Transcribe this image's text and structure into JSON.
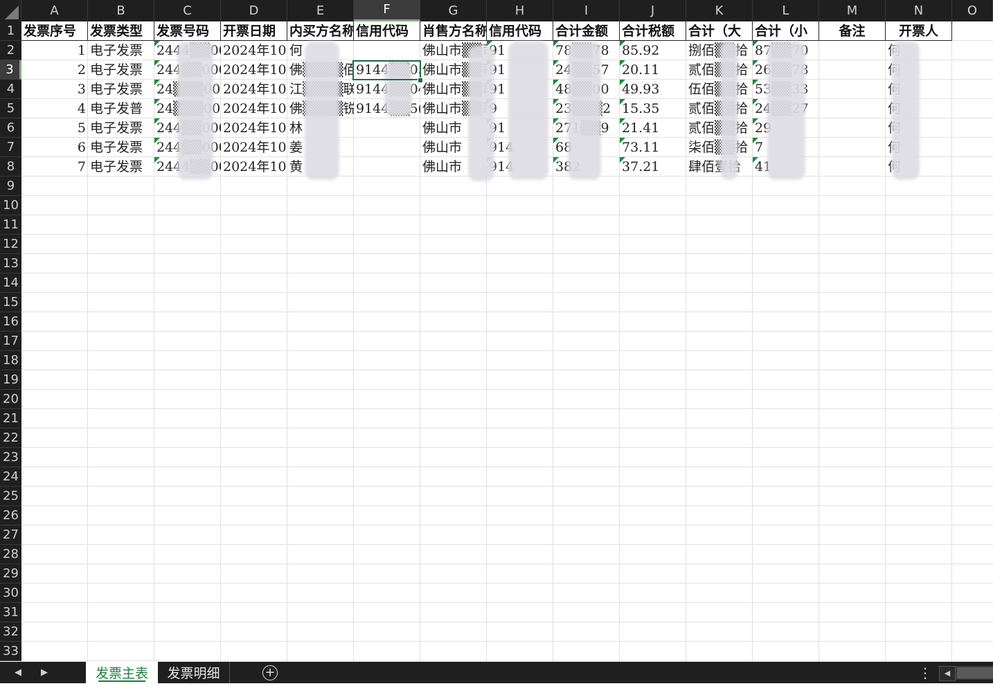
{
  "columns": [
    "A",
    "B",
    "C",
    "D",
    "E",
    "F",
    "G",
    "H",
    "I",
    "J",
    "K",
    "L",
    "M",
    "N",
    "O"
  ],
  "selected_column": "F",
  "selected_row": "3",
  "rows": [
    "1",
    "2",
    "3",
    "4",
    "5",
    "6",
    "7",
    "8",
    "9",
    "10",
    "11",
    "12",
    "13",
    "14",
    "15",
    "16",
    "17",
    "18",
    "19",
    "20",
    "21",
    "22",
    "23",
    "24",
    "25",
    "26",
    "27",
    "28",
    "29",
    "30",
    "31",
    "32",
    "33"
  ],
  "header_row": [
    "发票序号",
    "发票类型",
    "发票号码",
    "开票日期",
    "购买方名称",
    "信用代码",
    "销售方名称",
    "信用代码",
    "合计金额",
    "合计税额",
    "合计（大",
    "合计（小",
    "备注",
    "开票人"
  ],
  "header_display": [
    "发票序号",
    "发票类型",
    "发票号码",
    "开票日期",
    "内买方名称",
    "信用代码",
    "肖售方名称",
    "信用代码",
    "合计金额",
    "合计税额",
    "合计（大",
    "合计（小",
    "备注",
    "开票人"
  ],
  "data_rows": [
    [
      "1",
      "电子发票",
      "2444",
      "2024年10",
      "何",
      "",
      "佛山市",
      "91",
      "78",
      "85.92",
      "捌佰",
      "87",
      "",
      "何"
    ],
    [
      "2",
      "电子发票",
      "244",
      "2024年10",
      "佛",
      "9144",
      "佛山市",
      "91",
      "24",
      "20.11",
      "贰佰",
      "26",
      "",
      "何"
    ],
    [
      "3",
      "电子发票",
      "24",
      "2024年10",
      "江",
      "9144",
      "佛山市",
      "91",
      "48",
      "49.93",
      "伍佰",
      "53",
      "",
      "何"
    ],
    [
      "4",
      "电子发普",
      "24",
      "2024年10",
      "佛",
      "9144",
      "佛山市",
      "9",
      "23",
      "15.35",
      "贰佰",
      "24",
      "",
      "何"
    ],
    [
      "5",
      "电子发票",
      "244",
      "2024年10",
      "林",
      "",
      "佛山市",
      "91",
      "271",
      "21.41",
      "贰佰",
      "29",
      "",
      "何"
    ],
    [
      "6",
      "电子发票",
      "244",
      "2024年10",
      "姜",
      "",
      "佛山市",
      "914",
      "68",
      "73.11",
      "柒佰",
      "7",
      "",
      "何"
    ],
    [
      "7",
      "电子发票",
      "2444",
      "2024年10",
      "黄",
      "",
      "佛山市",
      "914",
      "382",
      "37.21",
      "肆佰壹拾",
      "41",
      "",
      "何"
    ]
  ],
  "data_display": [
    [
      "1",
      "电子发票",
      "2444▒▒000(",
      "2024年10",
      "何",
      "",
      "佛山市▒▒司",
      "91",
      "78▒▒78",
      "85.92",
      "捌佰▒▒拾",
      "87▒▒70",
      "",
      "何"
    ],
    [
      "2",
      "电子发票",
      "244▒▒000(",
      "2024年10",
      "佛▒▒▒▒佰",
      "9144▒▒05",
      "佛山市▒▒司",
      "91",
      "24▒▒57",
      "20.11",
      "贰佰▒▒拾",
      "26▒▒78",
      "",
      "何"
    ],
    [
      "3",
      "电子发票",
      "24▒▒▒000(",
      "2024年10",
      "江▒▒▒▒联",
      "9144▒▒04",
      "佛山市▒▒司",
      "91",
      "48▒▒00",
      "49.93",
      "伍佰▒▒拾",
      "53▒▒33",
      "",
      "何"
    ],
    [
      "4",
      "电子发普",
      "24▒▒▒000(",
      "2024年10",
      "佛▒▒▒▒锐",
      "9144▒▒5(",
      "佛山市▒▒司",
      "9",
      "23▒▒▒2",
      "15.35",
      "贰佰▒▒拾",
      "24▒▒27",
      "",
      "何"
    ],
    [
      "5",
      "电子发票",
      "244▒▒000(",
      "2024年10",
      "林",
      "",
      "佛山市",
      "91",
      "271▒▒9",
      "21.41",
      "贰佰▒▒拾",
      "29",
      "",
      "何"
    ],
    [
      "6",
      "电子发票",
      "244▒▒000(",
      "2024年10",
      "姜",
      "",
      "佛山市",
      "914",
      "68",
      "73.11",
      "柒佰▒▒拾",
      "7",
      "",
      "何"
    ],
    [
      "7",
      "电子发票",
      "2444▒▒00(",
      "2024年10",
      "黄",
      "",
      "佛山市",
      "914",
      "382",
      "37.21",
      "肆佰壹拾",
      "41",
      "",
      "何"
    ]
  ],
  "sheet_tabs": [
    {
      "label": "发票主表",
      "active": true
    },
    {
      "label": "发票明细",
      "active": false
    }
  ],
  "icons": {
    "prev_sheet": "caret-left-icon",
    "next_sheet": "caret-right-icon",
    "add_sheet": "plus-circle-icon",
    "more": "vertical-ellipsis-icon",
    "scroll_left": "scroll-left-icon"
  },
  "colors": {
    "header_bg": "#1f1f1f",
    "selection": "#1e6e3e",
    "active_tab_text": "#1e7e3e",
    "text_indicator": "#1e8c3a"
  }
}
